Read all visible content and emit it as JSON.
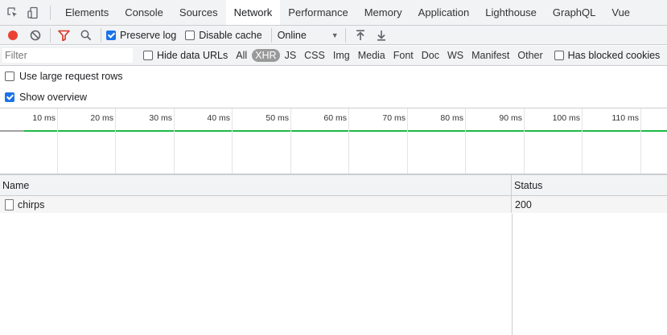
{
  "tabbar": {
    "tabs": [
      {
        "label": "Elements",
        "active": false
      },
      {
        "label": "Console",
        "active": false
      },
      {
        "label": "Sources",
        "active": false
      },
      {
        "label": "Network",
        "active": true
      },
      {
        "label": "Performance",
        "active": false
      },
      {
        "label": "Memory",
        "active": false
      },
      {
        "label": "Application",
        "active": false
      },
      {
        "label": "Lighthouse",
        "active": false
      },
      {
        "label": "GraphQL",
        "active": false
      },
      {
        "label": "Vue",
        "active": false
      }
    ]
  },
  "toolbar": {
    "preserve_log": {
      "label": "Preserve log",
      "checked": true
    },
    "disable_cache": {
      "label": "Disable cache",
      "checked": false
    },
    "throttling": {
      "value": "Online"
    }
  },
  "filterbar": {
    "placeholder": "Filter",
    "hide_data_urls": {
      "label": "Hide data URLs",
      "checked": false
    },
    "types": [
      {
        "label": "All",
        "active": false
      },
      {
        "label": "XHR",
        "active": true
      },
      {
        "label": "JS",
        "active": false
      },
      {
        "label": "CSS",
        "active": false
      },
      {
        "label": "Img",
        "active": false
      },
      {
        "label": "Media",
        "active": false
      },
      {
        "label": "Font",
        "active": false
      },
      {
        "label": "Doc",
        "active": false
      },
      {
        "label": "WS",
        "active": false
      },
      {
        "label": "Manifest",
        "active": false
      },
      {
        "label": "Other",
        "active": false
      }
    ],
    "has_blocked_cookies": {
      "label": "Has blocked cookies",
      "checked": false
    }
  },
  "settings": {
    "large_rows": {
      "label": "Use large request rows",
      "checked": false
    },
    "show_overview": {
      "label": "Show overview",
      "checked": true
    }
  },
  "overview": {
    "ticks": [
      "10 ms",
      "20 ms",
      "30 ms",
      "40 ms",
      "50 ms",
      "60 ms",
      "70 ms",
      "80 ms",
      "90 ms",
      "100 ms",
      "110 ms"
    ]
  },
  "table": {
    "columns": {
      "name": "Name",
      "status": "Status"
    },
    "rows": [
      {
        "name": "chirps",
        "status": "200"
      }
    ]
  },
  "colors": {
    "accent": "#1a73e8",
    "record": "#ea4335",
    "filter_active": "#d93025",
    "overview_line": "#1db847"
  }
}
